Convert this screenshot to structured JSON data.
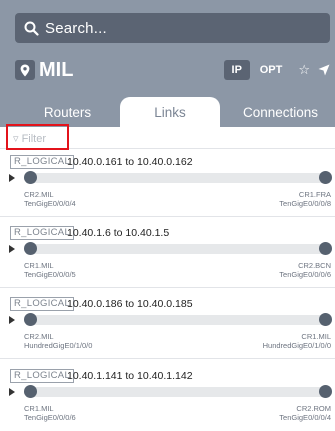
{
  "search": {
    "placeholder": "Search..."
  },
  "site": {
    "name": "MIL"
  },
  "toolbar": {
    "ip_label": "IP",
    "opt_label": "OPT",
    "star_icon": "☆"
  },
  "tabs": [
    {
      "label": "Routers"
    },
    {
      "label": "Links"
    },
    {
      "label": "Connections"
    }
  ],
  "filter": {
    "placeholder": "Filter",
    "highlight_color": "#e3131b"
  },
  "links": [
    {
      "type": "R_LOGICAL",
      "title": "10.40.0.161 to 10.40.0.162",
      "a": {
        "router": "CR2.MIL",
        "interface": "TenGigE0/0/0/4"
      },
      "b": {
        "router": "CR1.FRA",
        "interface": "TenGigE0/0/0/8"
      }
    },
    {
      "type": "R_LOGICAL",
      "title": "10.40.1.6 to 10.40.1.5",
      "a": {
        "router": "CR1.MIL",
        "interface": "TenGigE0/0/0/5"
      },
      "b": {
        "router": "CR2.BCN",
        "interface": "TenGigE0/0/0/6"
      }
    },
    {
      "type": "R_LOGICAL",
      "title": "10.40.0.186 to 10.40.0.185",
      "a": {
        "router": "CR2.MIL",
        "interface": "HundredGigE0/1/0/0"
      },
      "b": {
        "router": "CR1.MIL",
        "interface": "HundredGigE0/1/0/0"
      }
    },
    {
      "type": "R_LOGICAL",
      "title": "10.40.1.141 to 10.40.1.142",
      "a": {
        "router": "CR1.MIL",
        "interface": "TenGigE0/0/0/6"
      },
      "b": {
        "router": "CR2.ROM",
        "interface": "TenGigE0/0/0/4"
      }
    }
  ],
  "colors": {
    "header": "#8c97a6",
    "control": "#5b6473",
    "node_dot": "#56616f"
  }
}
